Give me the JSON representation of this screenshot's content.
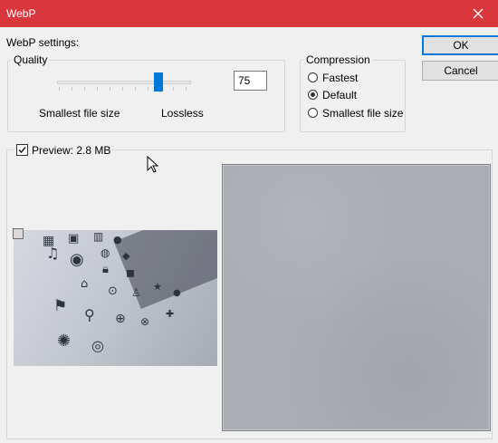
{
  "window": {
    "title": "WebP",
    "close_glyph": "✕"
  },
  "settings_label": "WebP settings:",
  "quality": {
    "group_label": "Quality",
    "value": "75",
    "level": 75,
    "min_label": "Smallest file size",
    "max_label": "Lossless"
  },
  "compression": {
    "group_label": "Compression",
    "options": [
      {
        "label": "Fastest",
        "checked": false
      },
      {
        "label": "Default",
        "checked": true
      },
      {
        "label": "Smallest file size",
        "checked": false
      }
    ]
  },
  "buttons": {
    "ok": "OK",
    "cancel": "Cancel"
  },
  "preview": {
    "label": "Preview: 2.8 MB",
    "checked": true
  },
  "icons": {
    "close": "close-icon",
    "cursor": "mouse-cursor-icon"
  },
  "colors": {
    "titlebar": "#d9363e",
    "accent": "#0078d7"
  }
}
